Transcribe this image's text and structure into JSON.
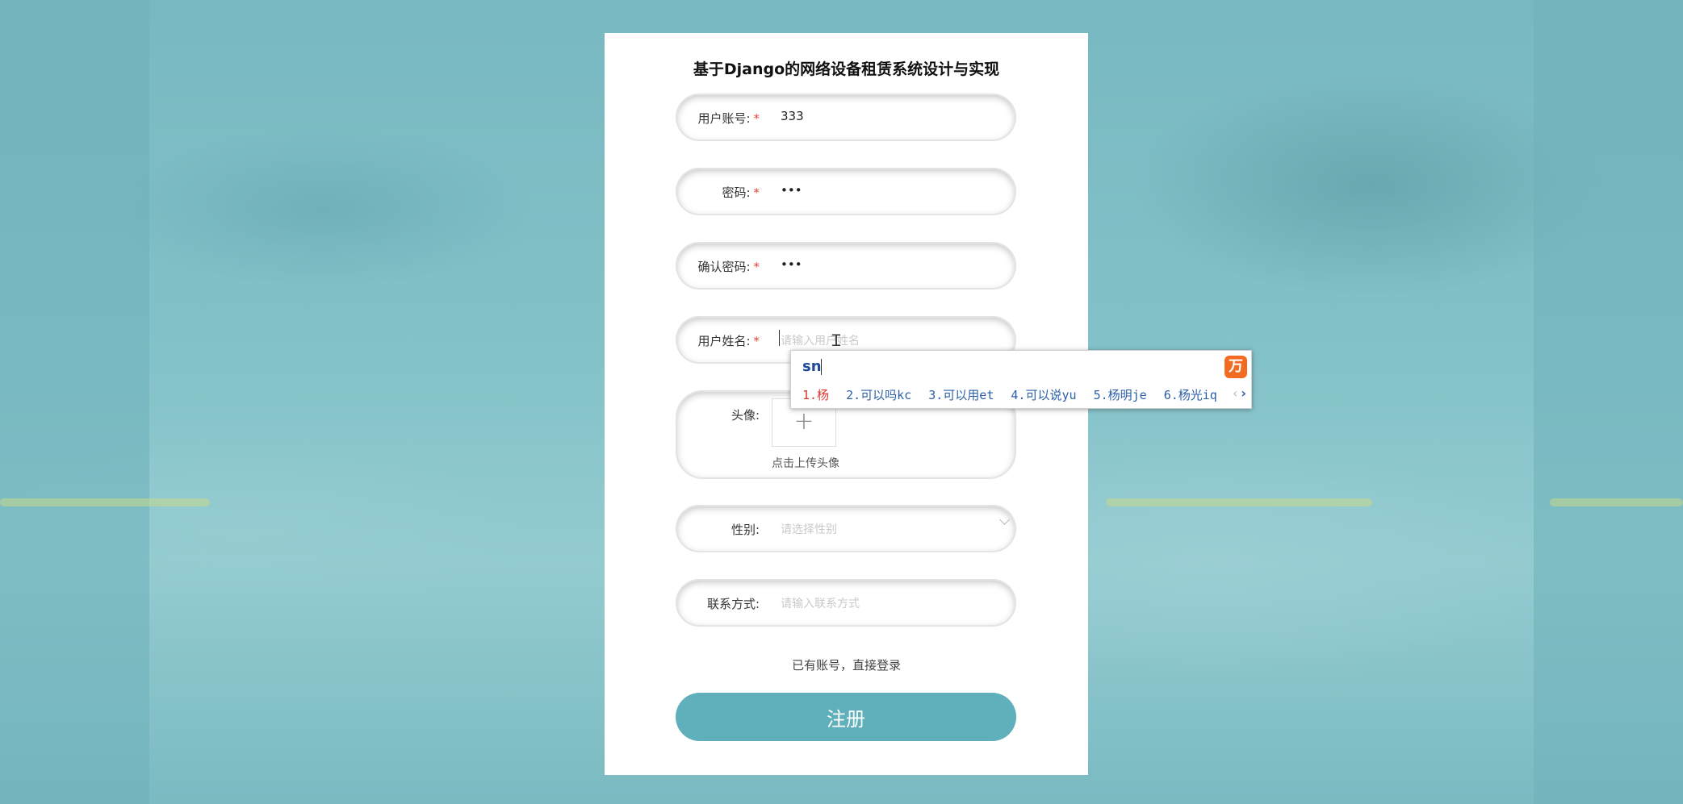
{
  "page": {
    "title": "基于Django的网络设备租赁系统设计与实现"
  },
  "form": {
    "account": {
      "label": "用户账号:",
      "required": "*",
      "value": "333"
    },
    "password": {
      "label": "密码:",
      "required": "*",
      "value": "•••"
    },
    "confirm_password": {
      "label": "确认密码:",
      "required": "*",
      "value": "•••"
    },
    "name": {
      "label": "用户姓名:",
      "required": "*",
      "placeholder": "请输入用户姓名"
    },
    "avatar": {
      "label": "头像:",
      "plus": "+",
      "upload_text": "点击上传头像"
    },
    "gender": {
      "label": "性别:",
      "placeholder": "请选择性别"
    },
    "contact": {
      "label": "联系方式:",
      "placeholder": "请输入联系方式"
    },
    "login_link": "已有账号，直接登录",
    "submit_label": "注册"
  },
  "ime": {
    "composition": "sn",
    "logo_icon": "ime-logo-icon",
    "candidates": [
      "1.杨",
      "2.可以吗kc",
      "3.可以用et",
      "4.可以说yu",
      "5.杨明je",
      "6.杨光iq"
    ],
    "prev": "‹",
    "next": "›"
  },
  "colors": {
    "button": "#5fb0ba",
    "required": "#e0453a",
    "ime_accent": "#f26b22",
    "ime_candidate": "#2b5fa8"
  }
}
